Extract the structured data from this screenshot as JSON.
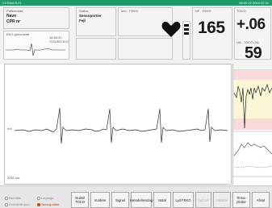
{
  "titlebar": {
    "left": "CCRAM 5.21",
    "right": "08:40 22 2004 02 52"
  },
  "patient": {
    "label": "Patientdata",
    "name": "Navn",
    "cpr": "CPR nr"
  },
  "status": {
    "label": "Status",
    "line1": "Sensoportier",
    "line2": "Fejl"
  },
  "info": {
    "label": "Info - FEKG"
  },
  "hr": {
    "label": "HF - FEKG",
    "value": "165"
  },
  "toco_top": {
    "label": "TOCO",
    "value": "+.06"
  },
  "toco_bottom": {
    "label": "UA - TOCO (%)",
    "value": "59"
  },
  "ekg_box": {
    "label": "EKG genomsnit",
    "time": "18:34:37",
    "sub": "TOG/RO 6.07"
  },
  "main_chart": {
    "left_label": "mS",
    "bottom_label": "2000 ms"
  },
  "bottom": {
    "radios": [
      {
        "label": "Normale",
        "active": false
      },
      {
        "label": "Lagrings",
        "active": false
      },
      {
        "label": "Overskrift ikon",
        "active": false
      },
      {
        "label": "Sensoportier",
        "active": true
      }
    ],
    "buttons": [
      {
        "label": "Nulstil TOCO",
        "enabled": true
      },
      {
        "label": "Vurdere",
        "enabled": true
      },
      {
        "label": "Signal",
        "enabled": true
      },
      {
        "label": "Hændelsesdag",
        "enabled": true
      },
      {
        "label": "Notat",
        "enabled": true
      },
      {
        "label": "Lyd FEKG",
        "enabled": true
      },
      {
        "label": "Lyd UA",
        "enabled": false
      },
      {
        "label": "Udskriv",
        "enabled": false
      },
      {
        "label": "Tema-plotter",
        "enabled": true
      },
      {
        "label": "Afslut",
        "enabled": true
      }
    ]
  },
  "colors": {
    "titlebar": "#1f9a6a",
    "active_radio": "#e05a2a",
    "heart": "#111111"
  },
  "icons": {
    "heart": "heart-icon",
    "signal": "signal-strength-icon"
  }
}
